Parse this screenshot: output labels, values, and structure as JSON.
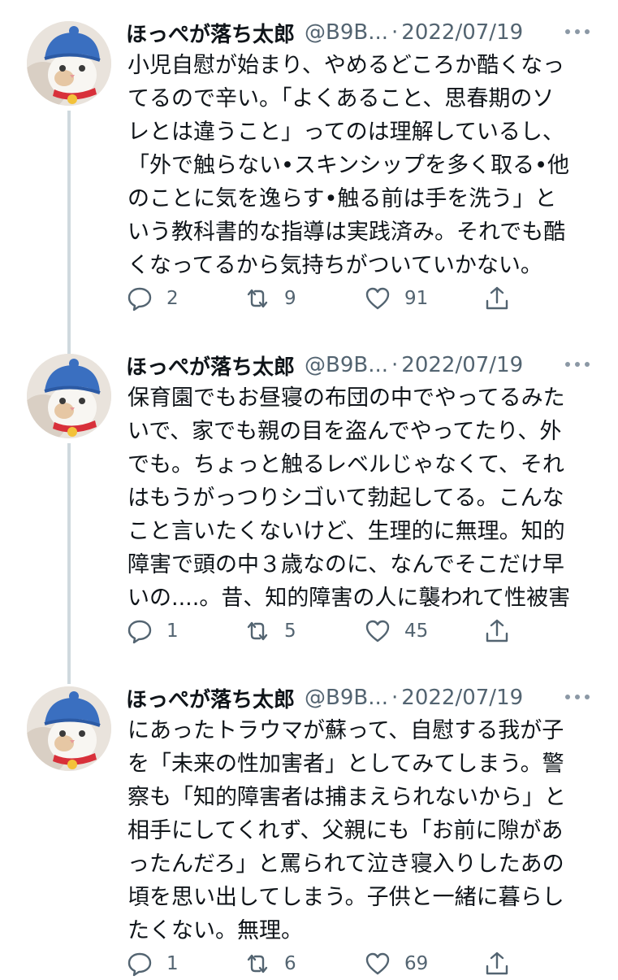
{
  "tweets": [
    {
      "display_name": "ほっぺが落ち太郎",
      "handle": "@B9B...",
      "separator": "·",
      "date": "2022/07/19",
      "text": "小児自慰が始まり、やめるどころか酷くなっ\nてるので辛い。「よくあること、思春期のソ\nレとは違うこと」ってのは理解しているし、\n「外で触らない•スキンシップを多く取る•他\nのことに気を逸らす•触る前は手を洗う」と\nいう教科書的な指導は実践済み。それでも酷\nくなってるから気持ちがついていかない。",
      "replies": "2",
      "retweets": "9",
      "likes": "91"
    },
    {
      "display_name": "ほっぺが落ち太郎",
      "handle": "@B9B...",
      "separator": "·",
      "date": "2022/07/19",
      "text": "保育園でもお昼寝の布団の中でやってるみた\nいで、家でも親の目を盗んでやってたり、外\nでも。ちょっと触るレベルじゃなくて、それ\nはもうがっつりシゴいて勃起してる。こんな\nこと言いたくないけど、生理的に無理。知的\n障害で頭の中３歳なのに、なんでそこだけ早\nいの....。昔、知的障害の人に襲われて性被害",
      "replies": "1",
      "retweets": "5",
      "likes": "45"
    },
    {
      "display_name": "ほっぺが落ち太郎",
      "handle": "@B9B...",
      "separator": "·",
      "date": "2022/07/19",
      "text": "にあったトラウマが蘇って、自慰する我が子\nを「未来の性加害者」としてみてしまう。警\n察も「知的障害者は捕まえられないから」と\n相手にしてくれず、父親にも「お前に隙があ\nったんだろ」と罵られて泣き寝入りしたあの\n頃を思い出してしまう。子供と一緒に暮らし\nたくない。無理。",
      "replies": "1",
      "retweets": "6",
      "likes": "69"
    }
  ],
  "icons": {
    "avatar": "cat-avatar",
    "reply": "reply-icon",
    "retweet": "retweet-icon",
    "like": "heart-icon",
    "share": "share-icon",
    "more": "more-icon"
  },
  "colors": {
    "text": "#0f1419",
    "secondary": "#536471",
    "thread_line": "#cfd9de",
    "avatar_hat": "#3a6fc0",
    "avatar_collar": "#d8303a",
    "avatar_bell": "#f3c23a"
  }
}
